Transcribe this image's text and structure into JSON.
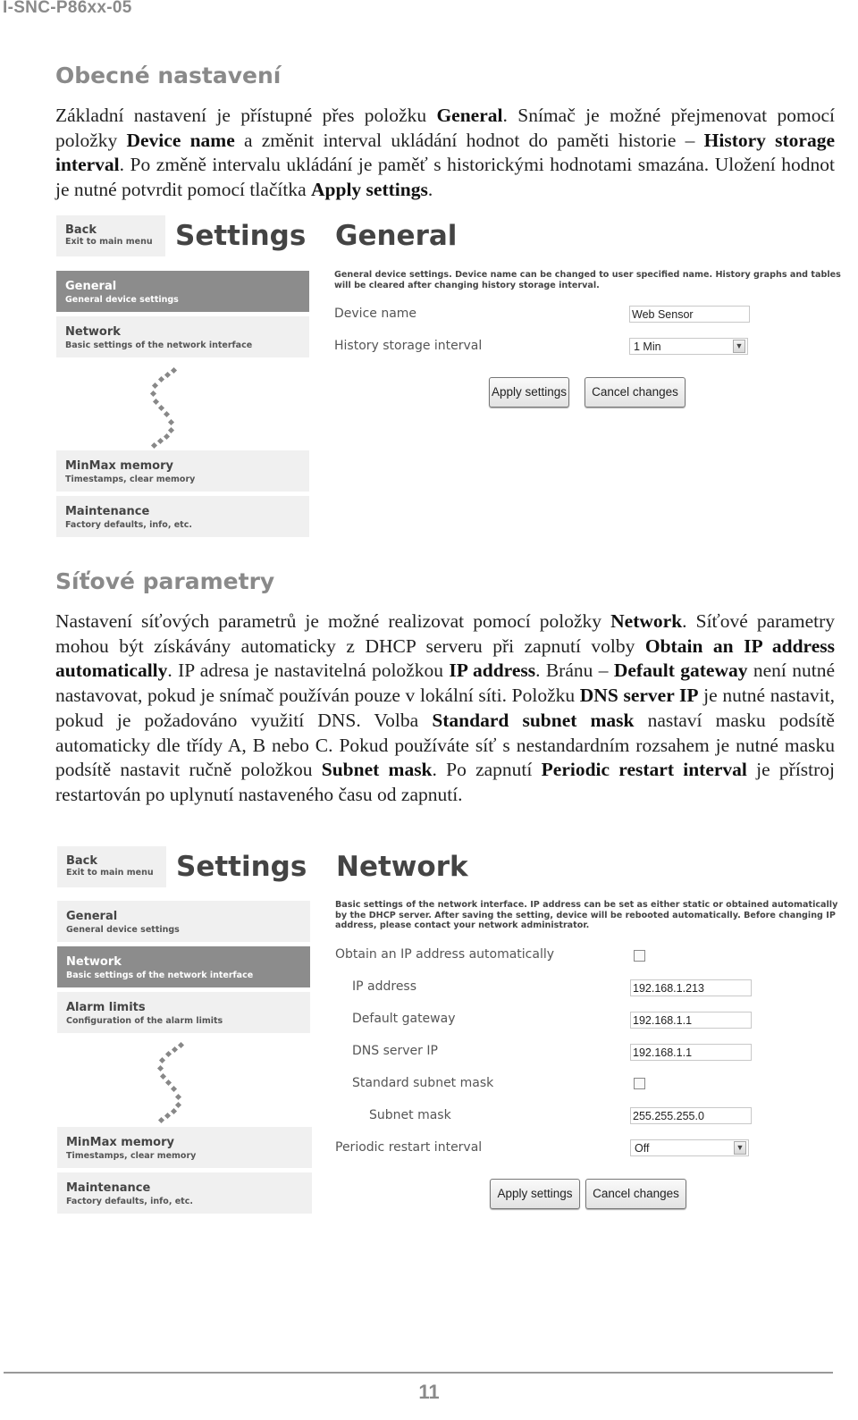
{
  "header": {
    "doc_code": "I-SNC-P86xx-05"
  },
  "section1": {
    "heading": "Obecné nastavení",
    "paragraph_parts": [
      {
        "t": "Základní nastavení je přístupné přes položku ",
        "b": false
      },
      {
        "t": "General",
        "b": true
      },
      {
        "t": ". Snímač je možné přejmenovat pomocí položky ",
        "b": false
      },
      {
        "t": "Device name",
        "b": true
      },
      {
        "t": " a změnit interval ukládání hodnot do paměti historie – ",
        "b": false
      },
      {
        "t": "History storage interval",
        "b": true
      },
      {
        "t": ". Po změně intervalu ukládání je paměť s historickými hodnotami smazána. Uložení hodnot je nutné potvrdit pomocí tlačítka ",
        "b": false
      },
      {
        "t": "Apply settings",
        "b": true
      },
      {
        "t": ".",
        "b": false
      }
    ]
  },
  "screenshot1": {
    "back": {
      "title": "Back",
      "subtitle": "Exit to main menu"
    },
    "settings_title": "Settings",
    "page_title": "General",
    "nav_items": [
      {
        "title": "General",
        "subtitle": "General device settings",
        "active": true
      },
      {
        "title": "Network",
        "subtitle": "Basic settings of the network interface",
        "active": false
      },
      {
        "title": "MinMax memory",
        "subtitle": "Timestamps, clear memory",
        "active": false
      },
      {
        "title": "Maintenance",
        "subtitle": "Factory defaults, info, etc.",
        "active": false
      }
    ],
    "description_lines": [
      "General device settings. Device name can be changed to user specified name. History graphs and tables",
      "will be cleared after changing history storage interval."
    ],
    "fields": {
      "device_name_label": "Device name",
      "device_name_value": "Web Sensor",
      "history_label": "History storage interval",
      "history_value": "1 Min"
    },
    "apply_label": "Apply settings",
    "cancel_label": "Cancel changes"
  },
  "section2": {
    "heading": "Síťové parametry",
    "paragraph_parts": [
      {
        "t": "Nastavení síťových parametrů je možné realizovat pomocí položky ",
        "b": false
      },
      {
        "t": "Network",
        "b": true
      },
      {
        "t": ". Síťové parametry mohou být získávány automaticky z DHCP serveru při zapnutí volby ",
        "b": false
      },
      {
        "t": "Obtain an IP address automatically",
        "b": true
      },
      {
        "t": ". IP adresa je nastavitelná položkou ",
        "b": false
      },
      {
        "t": "IP address",
        "b": true
      },
      {
        "t": ". Bránu – ",
        "b": false
      },
      {
        "t": "Default gateway",
        "b": true
      },
      {
        "t": " není nutné nastavovat, pokud je snímač používán pouze v lokální síti. Položku ",
        "b": false
      },
      {
        "t": "DNS server IP",
        "b": true
      },
      {
        "t": " je nutné nastavit, pokud je požadováno využití DNS. Volba ",
        "b": false
      },
      {
        "t": "Standard subnet mask",
        "b": true
      },
      {
        "t": " nastaví masku podsítě automaticky dle třídy A, B nebo C. Pokud používáte síť s nestandardním rozsahem je nutné masku podsítě nastavit ručně položkou ",
        "b": false
      },
      {
        "t": "Subnet mask",
        "b": true
      },
      {
        "t": ". Po zapnutí ",
        "b": false
      },
      {
        "t": "Periodic restart interval",
        "b": true
      },
      {
        "t": " je přístroj restartován po uplynutí nastaveného času od zapnutí.",
        "b": false
      }
    ]
  },
  "screenshot2": {
    "back": {
      "title": "Back",
      "subtitle": "Exit to main menu"
    },
    "settings_title": "Settings",
    "page_title": "Network",
    "nav_items": [
      {
        "title": "General",
        "subtitle": "General device settings",
        "active": false
      },
      {
        "title": "Network",
        "subtitle": "Basic settings of the network interface",
        "active": true
      },
      {
        "title": "Alarm limits",
        "subtitle": "Configuration of the alarm limits",
        "active": false
      },
      {
        "title": "MinMax memory",
        "subtitle": "Timestamps, clear memory",
        "active": false
      },
      {
        "title": "Maintenance",
        "subtitle": "Factory defaults, info, etc.",
        "active": false
      }
    ],
    "description_lines": [
      "Basic settings of the network interface. IP address can be set as either static or obtained automatically",
      "by the DHCP server. After saving the setting, device will be rebooted automatically. Before changing IP",
      "address, please contact your network administrator."
    ],
    "fields": {
      "obtain_auto_label": "Obtain an IP address automatically",
      "obtain_auto_checked": false,
      "ip_label": "IP address",
      "ip_value": "192.168.1.213",
      "gateway_label": "Default gateway",
      "gateway_value": "192.168.1.1",
      "dns_label": "DNS server IP",
      "dns_value": "192.168.1.1",
      "std_mask_label": "Standard subnet mask",
      "std_mask_checked": false,
      "mask_label": "Subnet mask",
      "mask_value": "255.255.255.0",
      "restart_label": "Periodic restart interval",
      "restart_value": "Off"
    },
    "apply_label": "Apply settings",
    "cancel_label": "Cancel changes"
  },
  "footer": {
    "page_number": "11"
  }
}
